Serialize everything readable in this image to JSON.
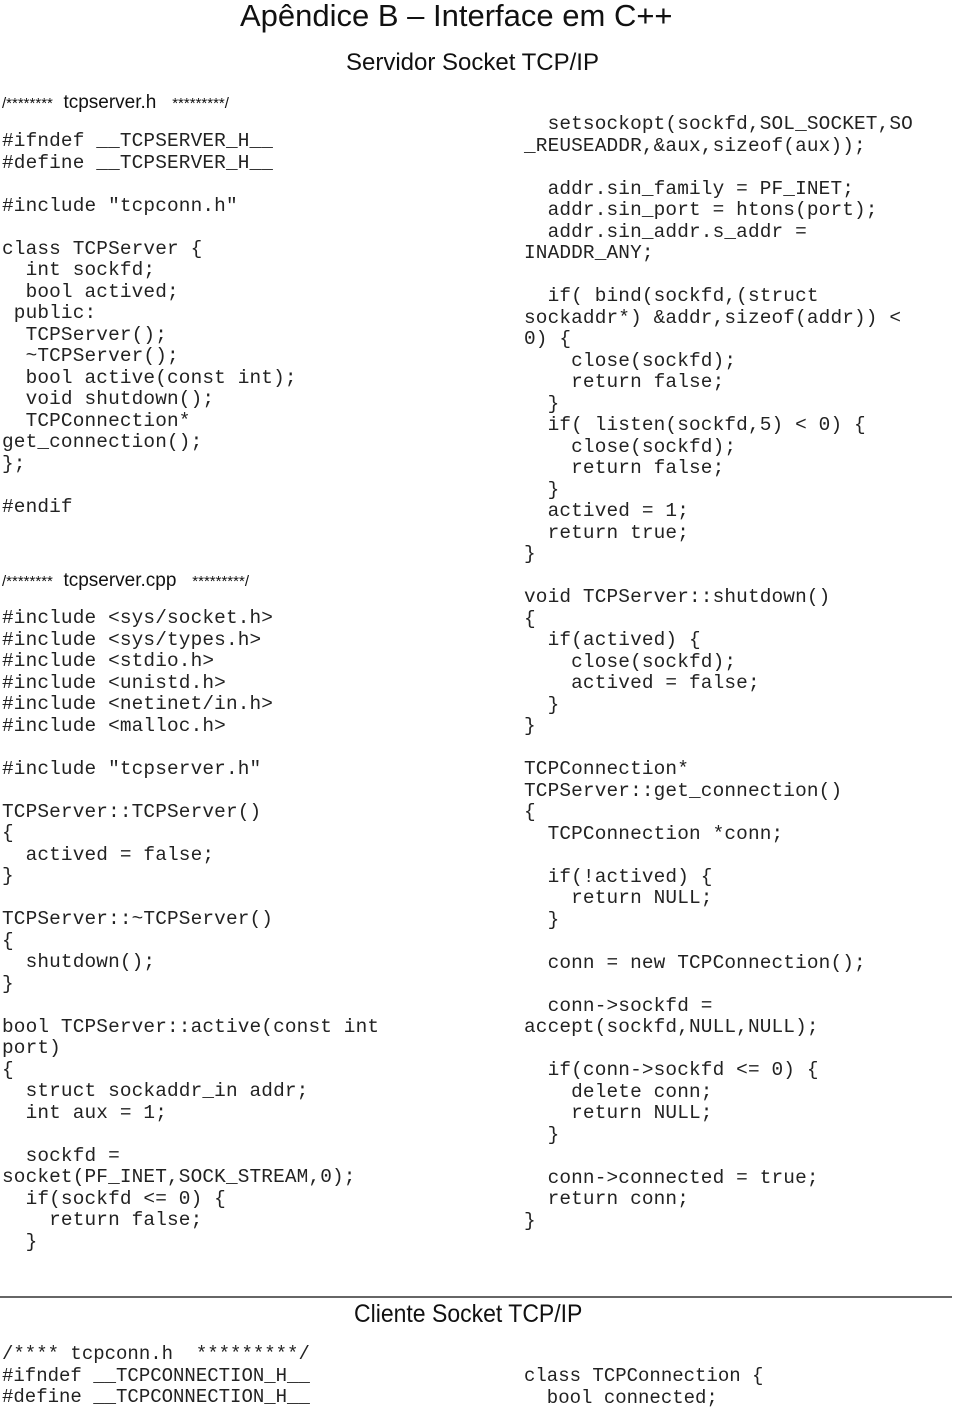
{
  "page": {
    "title": "Apêndice B – Interface em C++",
    "subtitle": "Servidor Socket TCP/IP"
  },
  "server": {
    "tcpserver_h": {
      "header_prefix": "/********",
      "filename": "tcpserver.h",
      "header_suffix": "*********/",
      "code": "#ifndef __TCPSERVER_H__\n#define __TCPSERVER_H__\n\n#include \"tcpconn.h\"\n\nclass TCPServer {\n  int sockfd;\n  bool actived;\n public:\n  TCPServer();\n  ~TCPServer();\n  bool active(const int);\n  void shutdown();\n  TCPConnection*\nget_connection();\n};\n\n#endif"
    },
    "tcpserver_cpp": {
      "header_prefix": "/********",
      "filename": "tcpserver.cpp",
      "header_suffix": "*********/",
      "code_left": "#include <sys/socket.h>\n#include <sys/types.h>\n#include <stdio.h>\n#include <unistd.h>\n#include <netinet/in.h>\n#include <malloc.h>\n\n#include \"tcpserver.h\"\n\nTCPServer::TCPServer()\n{\n  actived = false;\n}\n\nTCPServer::~TCPServer()\n{\n  shutdown();\n}\n\nbool TCPServer::active(const int\nport)\n{\n  struct sockaddr_in addr;\n  int aux = 1;\n\n  sockfd =\nsocket(PF_INET,SOCK_STREAM,0);\n  if(sockfd <= 0) {\n    return false;\n  }",
      "code_right": "  setsockopt(sockfd,SOL_SOCKET,SO\n_REUSEADDR,&aux,sizeof(aux));\n\n  addr.sin_family = PF_INET;\n  addr.sin_port = htons(port);\n  addr.sin_addr.s_addr =\nINADDR_ANY;\n\n  if( bind(sockfd,(struct\nsockaddr*) &addr,sizeof(addr)) <\n0) {\n    close(sockfd);\n    return false;\n  }\n  if( listen(sockfd,5) < 0) {\n    close(sockfd);\n    return false;\n  }\n  actived = 1;\n  return true;\n}\n\nvoid TCPServer::shutdown()\n{\n  if(actived) {\n    close(sockfd);\n    actived = false;\n  }\n}\n\nTCPConnection*\nTCPServer::get_connection()\n{\n  TCPConnection *conn;\n\n  if(!actived) {\n    return NULL;\n  }\n\n  conn = new TCPConnection();\n\n  conn->sockfd =\naccept(sockfd,NULL,NULL);\n\n  if(conn->sockfd <= 0) {\n    delete conn;\n    return NULL;\n  }\n\n  conn->connected = true;\n  return conn;\n}"
    }
  },
  "client": {
    "title": "Cliente Socket TCP/IP",
    "code_left": "/**** tcpconn.h  *********/\n#ifndef __TCPCONNECTION_H__\n#define __TCPCONNECTION_H__",
    "code_right": "class TCPConnection {\n  bool connected;"
  }
}
